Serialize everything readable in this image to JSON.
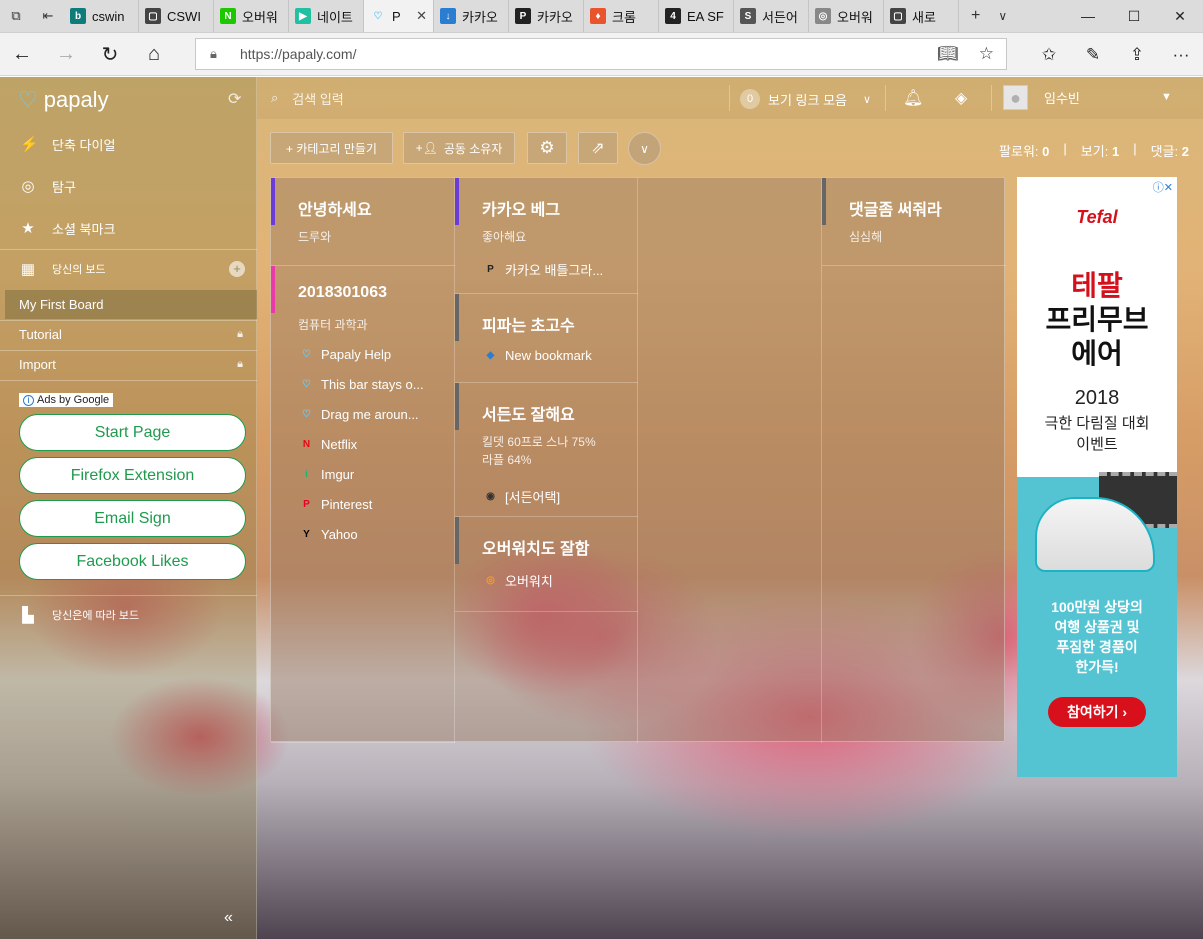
{
  "browser": {
    "tabs": [
      {
        "label": "cswin",
        "favicon": "bing-icon",
        "color": "#0f7c7c",
        "glyph": "b"
      },
      {
        "label": "CSWI",
        "favicon": "window-icon",
        "color": "#444444",
        "glyph": "▢"
      },
      {
        "label": "오버워",
        "favicon": "naver-icon",
        "color": "#1ec800",
        "glyph": "N"
      },
      {
        "label": "네이트",
        "favicon": "play-icon",
        "color": "#21c0a0",
        "glyph": "▶"
      },
      {
        "label": "P",
        "favicon": "papaly-icon",
        "color": "#6ecaf0",
        "glyph": "♡",
        "active": true
      },
      {
        "label": "카카오",
        "favicon": "download-icon",
        "color": "#2a7dd0",
        "glyph": "↓"
      },
      {
        "label": "카카오",
        "favicon": "pubg-icon",
        "color": "#222222",
        "glyph": "P"
      },
      {
        "label": "크롬",
        "favicon": "chrome-store-icon",
        "color": "#e9542c",
        "glyph": "♦"
      },
      {
        "label": "EA SF",
        "favicon": "ea-icon",
        "color": "#222222",
        "glyph": "4"
      },
      {
        "label": "서든어",
        "favicon": "sa-icon",
        "color": "#555555",
        "glyph": "S"
      },
      {
        "label": "오버워",
        "favicon": "overwatch-icon",
        "color": "#888888",
        "glyph": "◎"
      },
      {
        "label": "새로",
        "favicon": "window-icon",
        "color": "#444444",
        "glyph": "▢"
      }
    ],
    "url": "https://papaly.com/"
  },
  "app": {
    "logo_text": "papaly",
    "search_placeholder": "검색 입력",
    "links_count": "0",
    "links_label": "보기 링크 모음",
    "user_name": "임수빈",
    "nav": [
      {
        "label": "단축 다이얼",
        "icon": "bolt-icon",
        "glyph": "⚡"
      },
      {
        "label": "탐구",
        "icon": "compass-icon",
        "glyph": "◎"
      },
      {
        "label": "소셜 북마크",
        "icon": "star-icon",
        "glyph": "★"
      }
    ],
    "boards_header": "당신의 보드",
    "boards": [
      {
        "label": "My First Board",
        "active": true,
        "locked": false
      },
      {
        "label": "Tutorial",
        "active": false,
        "locked": true
      },
      {
        "label": "Import",
        "active": false,
        "locked": true
      }
    ],
    "ads_by": "Ads by Google",
    "ad_links": [
      "Start Page",
      "Firefox Extension",
      "Email Sign",
      "Facebook Likes"
    ],
    "follow_boards": "당신은에 따라 보드",
    "toolbar": {
      "create_category": "+ 카테고리 만들기",
      "co_owner": "공동 소유자"
    },
    "stats": {
      "followers_label": "팔로워:",
      "followers": "0",
      "views_label": "보기:",
      "views": "1",
      "comments_label": "댓글:",
      "comments": "2"
    }
  },
  "categories": [
    {
      "id": "c1",
      "title": "안녕하세요",
      "subtitle": "드루와",
      "color": "#6a3cd8",
      "bookmarks": []
    },
    {
      "id": "c2",
      "title": "2018301063",
      "subtitle": "컴퓨터 과학과",
      "color": "#e83aa8",
      "bookmarks": [
        {
          "label": "Papaly Help",
          "icon": "papaly-icon",
          "glyph": "♡",
          "color": "#6ecaf0"
        },
        {
          "label": "This bar stays o...",
          "icon": "papaly-icon",
          "glyph": "♡",
          "color": "#6ecaf0"
        },
        {
          "label": "Drag me aroun...",
          "icon": "papaly-icon",
          "glyph": "♡",
          "color": "#6ecaf0"
        },
        {
          "label": "Netflix",
          "icon": "netflix-icon",
          "glyph": "N",
          "color": "#e50914"
        },
        {
          "label": "Imgur",
          "icon": "imgur-icon",
          "glyph": "i",
          "color": "#1bb76e"
        },
        {
          "label": "Pinterest",
          "icon": "pinterest-icon",
          "glyph": "P",
          "color": "#e60023"
        },
        {
          "label": "Yahoo",
          "icon": "yahoo-icon",
          "glyph": "Y",
          "color": "#000000"
        }
      ]
    },
    {
      "id": "c3",
      "title": "카카오 베그",
      "subtitle": "좋아해요",
      "color": "#6a3cd8",
      "bookmarks": [
        {
          "label": "카카오 배틀그라...",
          "icon": "pubg-icon",
          "glyph": "P",
          "color": "#222222"
        }
      ]
    },
    {
      "id": "c4",
      "title": "피파는 초고수",
      "subtitle": "",
      "color": "#666666",
      "bookmarks": [
        {
          "label": "New bookmark",
          "icon": "bookmark-icon",
          "glyph": "◆",
          "color": "#2a7dd0"
        }
      ]
    },
    {
      "id": "c5",
      "title": "서든도 잘해요",
      "subtitle": "킬뎃 60프로 스나 75%",
      "subtitle2": "라플 64%",
      "color": "#666666",
      "bookmarks": [
        {
          "label": "[서든어택]",
          "icon": "sudden-attack-icon",
          "glyph": "◉",
          "color": "#333333"
        }
      ]
    },
    {
      "id": "c6",
      "title": "오버워치도 잘함",
      "subtitle": "",
      "color": "#666666",
      "bookmarks": [
        {
          "label": "오버워치",
          "icon": "overwatch-icon",
          "glyph": "◎",
          "color": "#f99e1a"
        }
      ]
    },
    {
      "id": "c7",
      "title": "댓글좀 써줘라",
      "subtitle": "심심해",
      "color": "#666666",
      "bookmarks": []
    }
  ],
  "ad": {
    "brand": "Tefal",
    "headline_1": "테팔",
    "headline_2": "프리무브",
    "headline_3": "에어",
    "year": "2018",
    "sub_1": "극한 다림질 대회",
    "sub_2": "이벤트",
    "desc_1": "100만원 상당의",
    "desc_2": "여행 상품권 및",
    "desc_3": "푸짐한 경품이",
    "desc_4": "한가득!",
    "cta": "참여하기 ›"
  }
}
